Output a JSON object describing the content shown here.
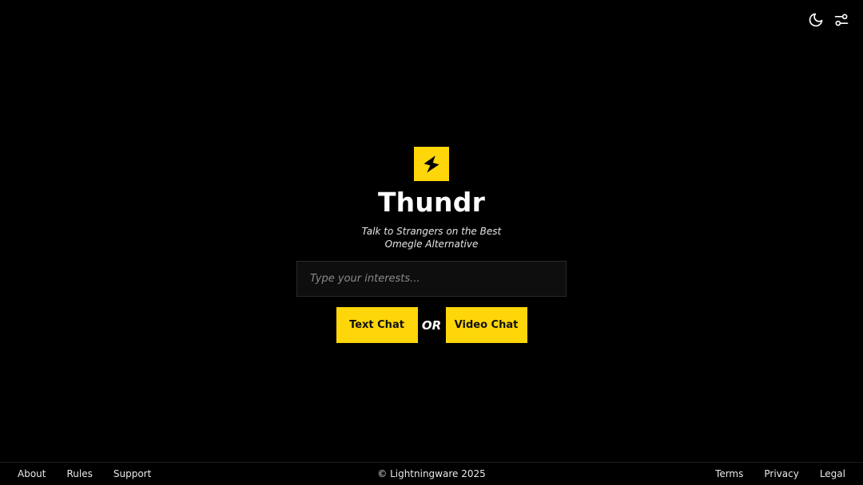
{
  "header": {
    "icons": [
      "moon-icon",
      "sliders-icon"
    ]
  },
  "brand": {
    "name": "Thundr",
    "tagline": "Talk to Strangers on the Best Omegle Alternative",
    "logo_icon": "lightning-icon",
    "accent_color": "#ffd60a"
  },
  "search": {
    "placeholder": "Type your interests...",
    "value": ""
  },
  "actions": {
    "text_chat_label": "Text Chat",
    "or_label": "OR",
    "video_chat_label": "Video Chat"
  },
  "footer": {
    "left_links": [
      "About",
      "Rules",
      "Support"
    ],
    "copyright": "© Lightningware 2025",
    "right_links": [
      "Terms",
      "Privacy",
      "Legal"
    ]
  }
}
